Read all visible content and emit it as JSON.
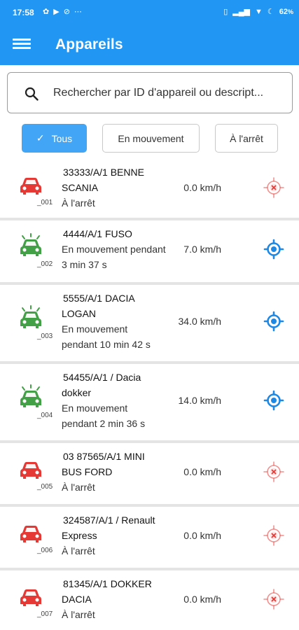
{
  "status_bar": {
    "time": "17:58",
    "battery": "62"
  },
  "app_bar": {
    "title": "Appareils",
    "menu_icon": "hamburger-menu-icon"
  },
  "search": {
    "placeholder": "Rechercher par ID d'appareil ou descript..."
  },
  "filters": {
    "all": "Tous",
    "moving": "En mouvement",
    "stopped": "À l'arrêt",
    "selected": "all"
  },
  "colors": {
    "primary": "#2196f3",
    "chip_selected": "#42a5f5",
    "stopped": "#e53935",
    "moving": "#43a047",
    "locate": "#1e88e5"
  },
  "devices": [
    {
      "id": "_001",
      "name_line1": "33333/A/1 BENNE",
      "name_line2": "SCANIA",
      "status_line1": "À l'arrêt",
      "status_line2": "",
      "speed": "0.0 km/h",
      "state": "stopped"
    },
    {
      "id": "_002",
      "name_line1": "4444/A/1  FUSO",
      "name_line2": "",
      "status_line1": "En mouvement pendant",
      "status_line2": "3 min 37 s",
      "speed": "7.0 km/h",
      "state": "moving"
    },
    {
      "id": "_003",
      "name_line1": "5555/A/1  DACIA",
      "name_line2": "LOGAN",
      "status_line1": "En mouvement",
      "status_line2": "pendant 10 min 42 s",
      "speed": "34.0 km/h",
      "state": "moving"
    },
    {
      "id": "_004",
      "name_line1": "54455/A/1  / Dacia",
      "name_line2": "dokker",
      "status_line1": "En mouvement",
      "status_line2": "pendant 2 min 36 s",
      "speed": "14.0 km/h",
      "state": "moving"
    },
    {
      "id": "_005",
      "name_line1": "03  87565/A/1  MINI",
      "name_line2": "BUS FORD",
      "status_line1": "À l'arrêt",
      "status_line2": "",
      "speed": "0.0 km/h",
      "state": "stopped"
    },
    {
      "id": "_006",
      "name_line1": "324587/A/1  / Renault",
      "name_line2": "Express",
      "status_line1": "À l'arrêt",
      "status_line2": "",
      "speed": "0.0 km/h",
      "state": "stopped"
    },
    {
      "id": "_007",
      "name_line1": "81345/A/1 DOKKER",
      "name_line2": "DACIA",
      "status_line1": "À l'arrêt",
      "status_line2": "",
      "speed": "0.0 km/h",
      "state": "stopped"
    }
  ]
}
